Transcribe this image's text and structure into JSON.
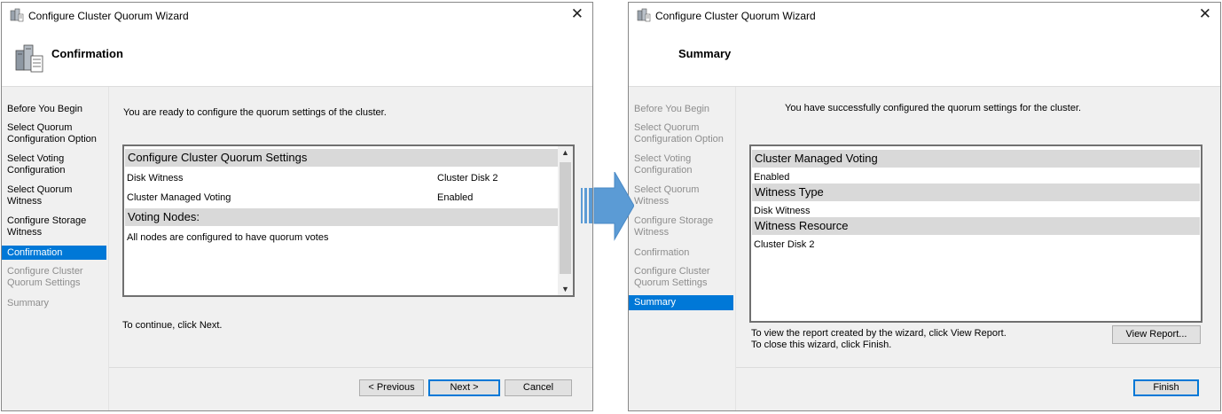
{
  "wizard_title": "Configure Cluster Quorum Wizard",
  "colors": {
    "accent": "#0078d7",
    "group_header": "#d9d9d9",
    "panel": "#f0f0f0",
    "arrow": "#5b9bd5"
  },
  "left": {
    "page_title": "Confirmation",
    "nav": [
      "Before You Begin",
      "Select Quorum Configuration Option",
      "Select Voting Configuration",
      "Select Quorum Witness",
      "Configure Storage Witness",
      "Confirmation",
      "Configure Cluster Quorum Settings",
      "Summary"
    ],
    "intro": "You are ready to configure the quorum settings of the cluster.",
    "settings": {
      "header1": "Configure Cluster Quorum Settings",
      "rows": [
        {
          "label": "Disk Witness",
          "value": "Cluster Disk 2"
        },
        {
          "label": "Cluster Managed Voting",
          "value": "Enabled"
        }
      ],
      "header2": "Voting Nodes:",
      "nodes_text": "All nodes are configured to have quorum votes"
    },
    "continue_text": "To continue, click Next.",
    "buttons": {
      "previous": "< Previous",
      "next": "Next >",
      "cancel": "Cancel"
    }
  },
  "right": {
    "page_title": "Summary",
    "nav": [
      "Before You Begin",
      "Select Quorum Configuration Option",
      "Select Voting Configuration",
      "Select Quorum Witness",
      "Configure Storage Witness",
      "Confirmation",
      "Configure Cluster Quorum Settings",
      "Summary"
    ],
    "intro": "You have successfully configured the quorum settings for the cluster.",
    "results": [
      {
        "header": "Cluster Managed Voting",
        "value": "Enabled"
      },
      {
        "header": "Witness Type",
        "value": "Disk Witness"
      },
      {
        "header": "Witness Resource",
        "value": "Cluster Disk 2"
      }
    ],
    "report_text_1": "To view the report created by the wizard, click View Report.",
    "report_text_2": "To close this wizard, click Finish.",
    "buttons": {
      "view_report": "View Report...",
      "finish": "Finish"
    }
  }
}
